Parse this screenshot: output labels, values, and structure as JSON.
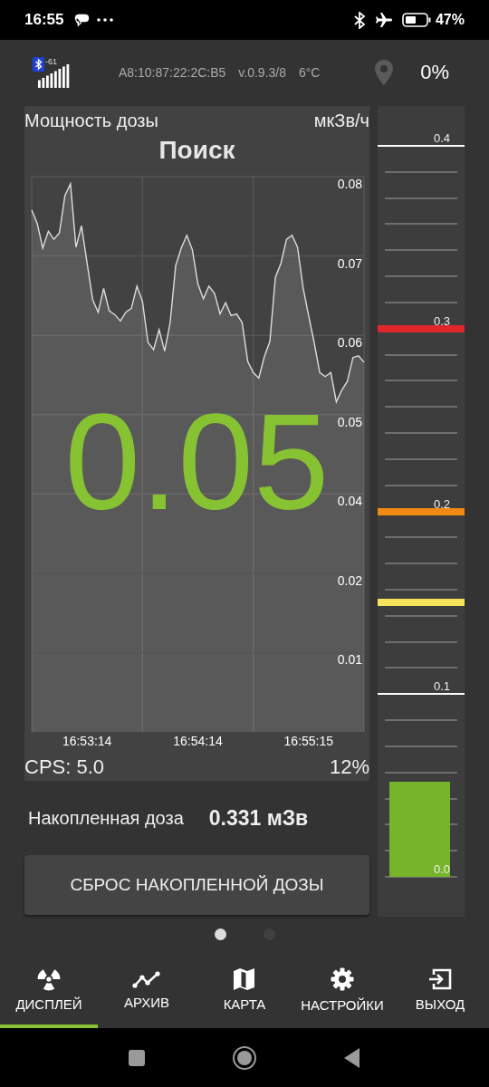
{
  "status_bar": {
    "time": "16:55",
    "battery": "47%"
  },
  "header": {
    "rssi": "-61",
    "address": "A8:10:87:22:2C:B5",
    "version": "v.0.9.3/8",
    "temperature": "6°C",
    "charge": "0%"
  },
  "dose_rate_panel": {
    "title": "Мощность дозы",
    "unit": "мкЗв/ч",
    "mode": "Поиск",
    "value": "0.05",
    "cps": "CPS: 5.0",
    "percent": "12%",
    "chart_data": {
      "type": "area",
      "categories": [
        null,
        null,
        null,
        null,
        null,
        null,
        null,
        null,
        null,
        null,
        "16:53:14",
        null,
        null,
        null,
        null,
        null,
        null,
        null,
        null,
        null,
        null,
        null,
        null,
        null,
        null,
        null,
        null,
        null,
        null,
        null,
        "16:54:14",
        null,
        null,
        null,
        null,
        null,
        null,
        null,
        null,
        null,
        null,
        null,
        null,
        null,
        null,
        null,
        null,
        null,
        null,
        null,
        "16:55:15",
        null,
        null,
        null,
        null,
        null,
        null,
        null,
        null,
        null,
        null
      ],
      "series": [
        {
          "color": "#dddddd",
          "values": [
            0.0758,
            0.0741,
            0.071,
            0.0731,
            0.0721,
            0.0729,
            0.0776,
            0.0791,
            0.0711,
            0.0738,
            0.0691,
            0.0645,
            0.0629,
            0.0659,
            0.0631,
            0.0626,
            0.0618,
            0.0629,
            0.0634,
            0.0662,
            0.0643,
            0.0591,
            0.0582,
            0.0607,
            0.058,
            0.0616,
            0.0688,
            0.071,
            0.0726,
            0.0708,
            0.0665,
            0.0646,
            0.0662,
            0.0653,
            0.0627,
            0.0641,
            0.0625,
            0.0627,
            0.0616,
            0.0567,
            0.0553,
            0.0546,
            0.0573,
            0.0592,
            0.0673,
            0.0691,
            0.0721,
            0.0726,
            0.0711,
            0.066,
            0.0625,
            0.0591,
            0.0553,
            0.0548,
            0.0553,
            0.0516,
            0.0531,
            0.0542,
            0.0572,
            0.0574,
            0.0566
          ]
        }
      ],
      "ylim": [
        0.01,
        0.08
      ],
      "grid": true,
      "yticks": [
        0.08,
        0.07,
        0.06,
        0.05,
        0.04
      ]
    },
    "lower_axis_labels": [
      "0.02",
      "0.01"
    ]
  },
  "gauge": {
    "labels": [
      "0.4",
      "0.3",
      "0.2",
      "0.1",
      "0.0"
    ],
    "alarms": [
      {
        "color": "#e0262b",
        "level": 0.75
      },
      {
        "color": "#f08a12",
        "level": 0.5
      },
      {
        "color": "#f6e35a",
        "level": 0.375
      }
    ],
    "level": 0.13
  },
  "accumulated": {
    "label": "Накопленная доза",
    "value": "0.331 мЗв"
  },
  "reset_button": "СБРОС НАКОПЛЕННОЙ ДОЗЫ",
  "pages": [
    {
      "selected": true
    },
    {
      "selected": false
    }
  ],
  "tabs": [
    {
      "label": "ДИСПЛЕЙ",
      "selected": true
    },
    {
      "label": "АРХИВ",
      "selected": false
    },
    {
      "label": "КАРТА",
      "selected": false
    },
    {
      "label": "НАСТРОЙКИ",
      "selected": false
    },
    {
      "label": "ВЫХОД",
      "selected": false
    }
  ]
}
